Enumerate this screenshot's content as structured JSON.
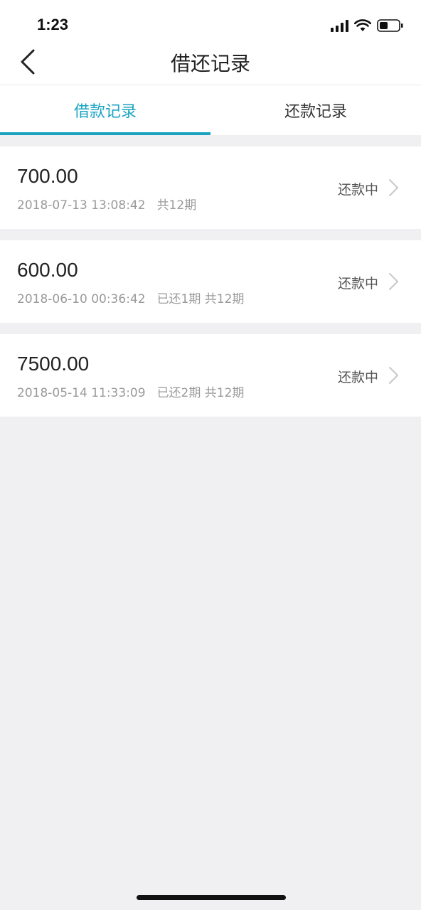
{
  "status_bar": {
    "time": "1:23",
    "icons": [
      "signal-icon",
      "wifi-icon",
      "battery-icon"
    ]
  },
  "nav": {
    "title": "借还记录",
    "back_icon": "chevron-left-icon"
  },
  "tabs": [
    {
      "label": "借款记录",
      "active": true
    },
    {
      "label": "还款记录",
      "active": false
    }
  ],
  "records": [
    {
      "amount": "700.00",
      "datetime": "2018-07-13 13:08:42",
      "periods": "共12期",
      "status": "还款中"
    },
    {
      "amount": "600.00",
      "datetime": "2018-06-10 00:36:42",
      "periods": "已还1期 共12期",
      "status": "还款中"
    },
    {
      "amount": "7500.00",
      "datetime": "2018-05-14 11:33:09",
      "periods": "已还2期 共12期",
      "status": "还款中"
    }
  ],
  "colors": {
    "accent": "#1ca3c2",
    "background": "#f0f0f2",
    "card": "#ffffff",
    "secondary_text": "#9a9a9a"
  }
}
